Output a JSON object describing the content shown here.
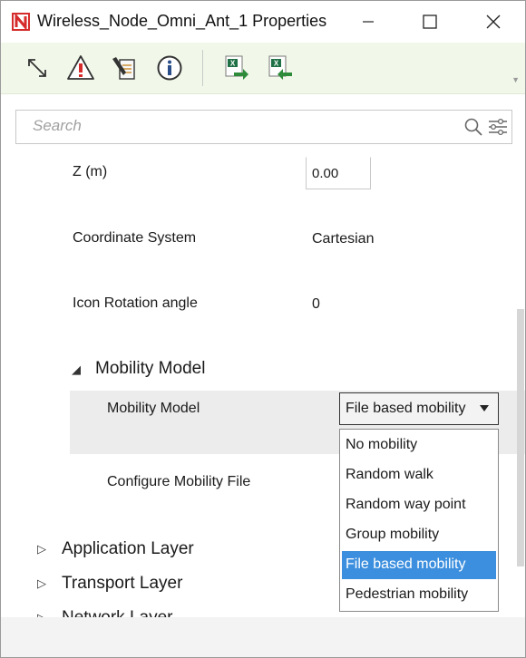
{
  "window": {
    "title": "Wireless_Node_Omni_Ant_1 Properties",
    "app_icon_letter": "N",
    "brand_color": "#d62b2b"
  },
  "toolbar": {
    "buttons": [
      {
        "name": "expand-collapse-icon"
      },
      {
        "name": "warning-icon"
      },
      {
        "name": "edit-document-icon"
      },
      {
        "name": "info-icon"
      },
      {
        "name": "excel-export-icon"
      },
      {
        "name": "excel-import-icon"
      }
    ],
    "background": "#f1f8e9"
  },
  "search": {
    "placeholder": "Search"
  },
  "properties": {
    "z_label": "Z (m)",
    "z_value": "0.00",
    "coord_label": "Coordinate System",
    "coord_value": "Cartesian",
    "rotation_label": "Icon Rotation angle",
    "rotation_value": "0",
    "mobility_group": "Mobility Model",
    "mobility_label": "Mobility Model",
    "mobility_selected": "File based mobility",
    "config_file_label": "Configure Mobility File"
  },
  "dropdown": {
    "options": [
      "No mobility",
      "Random walk",
      "Random way point",
      "Group mobility",
      "File based mobility",
      "Pedestrian mobility"
    ],
    "selected_index": 4,
    "selected_color": "#3c8fde"
  },
  "groups": {
    "application": "Application Layer",
    "transport": "Transport Layer",
    "network": "Network Layer"
  }
}
